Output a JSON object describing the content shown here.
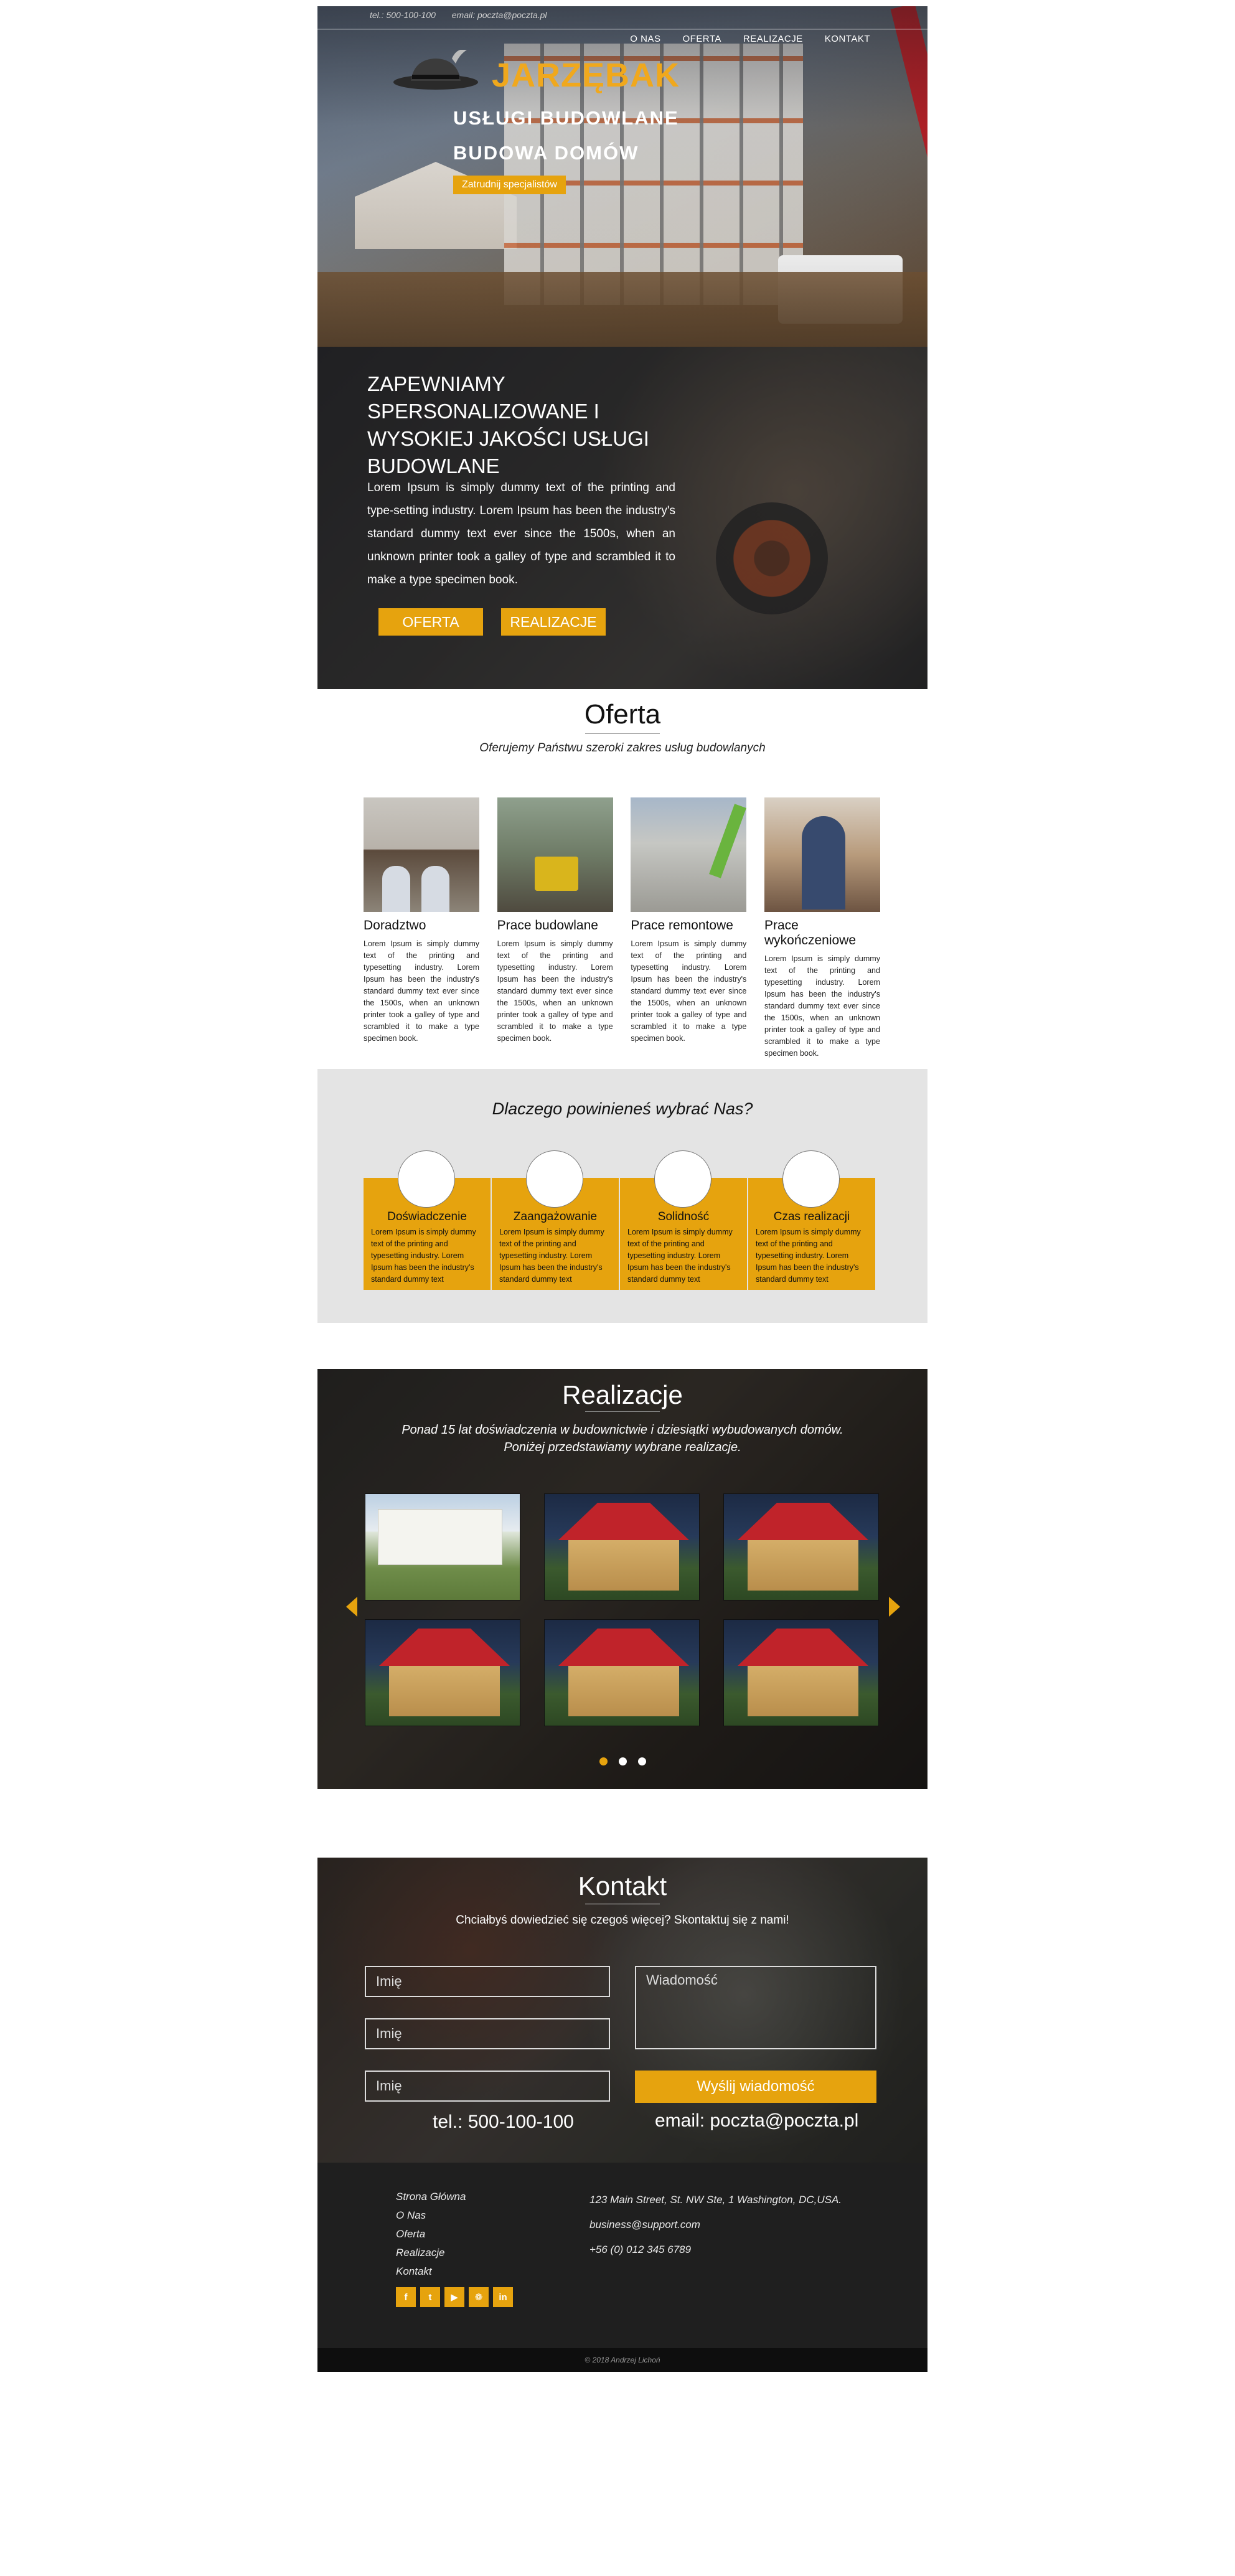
{
  "topbar": {
    "phone": "tel.: 500-100-100",
    "email": "email: poczta@poczta.pl"
  },
  "nav": {
    "items": [
      "O NAS",
      "OFERTA",
      "REALIZACJE",
      "KONTAKT"
    ]
  },
  "logo": {
    "text": "JARZĘBAK"
  },
  "hero": {
    "tagline_1": "USŁUGI BUDOWLANE",
    "tagline_2": "BUDOWA DOMÓW",
    "cta": "Zatrudnij specjalistów"
  },
  "intro": {
    "title": "ZAPEWNIAMY SPERSONALIZOWANE I WYSOKIEJ JAKOŚCI USŁUGI BUDOWLANE",
    "text": "Lorem Ipsum is simply dummy text of the printing and type-setting industry. Lorem Ipsum has been the industry's standard dummy text ever since the 1500s, when an unknown printer took a galley of type and scrambled it to make a type specimen book.",
    "button_offer": "OFERTA",
    "button_realizations": "REALIZACJE"
  },
  "oferta": {
    "title": "Oferta",
    "subtitle": "Oferujemy Państwu szeroki zakres usług budowlanych",
    "services": [
      {
        "title": "Doradztwo",
        "text": "Lorem Ipsum is simply dummy text of the printing and typesetting industry. Lorem Ipsum has been the industry's standard dummy text ever since the 1500s, when an unknown printer took a galley of type and scrambled it to make a type specimen book."
      },
      {
        "title": "Prace budowlane",
        "text": "Lorem Ipsum is simply dummy text of the printing and typesetting industry. Lorem Ipsum has been the industry's standard dummy text ever since the 1500s, when an unknown printer took a galley of type and scrambled it to make a type specimen book."
      },
      {
        "title": "Prace remontowe",
        "text": "Lorem Ipsum is simply dummy text of the printing and typesetting industry. Lorem Ipsum has been the industry's standard dummy text ever since the 1500s, when an unknown printer took a galley of type and scrambled it to make a type specimen book."
      },
      {
        "title": "Prace wykończeniowe",
        "text": "Lorem Ipsum is simply dummy text of the printing and typesetting industry. Lorem Ipsum has been the industry's standard dummy text ever since the 1500s, when an unknown printer took a galley of type and scrambled it to make a type specimen book."
      }
    ]
  },
  "why": {
    "title": "Dlaczego powinieneś wybrać Nas?",
    "features": [
      {
        "title": "Doświadczenie",
        "text": "Lorem Ipsum is simply dummy text of the printing and typesetting industry. Lorem Ipsum has been the industry's standard dummy text"
      },
      {
        "title": "Zaangażowanie",
        "text": "Lorem Ipsum is simply dummy text of the printing and typesetting industry. Lorem Ipsum has been the industry's standard dummy text"
      },
      {
        "title": "Solidność",
        "text": "Lorem Ipsum is simply dummy text of the printing and typesetting industry. Lorem Ipsum has been the industry's standard dummy text"
      },
      {
        "title": "Czas realizacji",
        "text": "Lorem Ipsum is simply dummy text of the printing and typesetting industry. Lorem Ipsum has been the industry's standard dummy text"
      }
    ]
  },
  "realizacje": {
    "title": "Realizacje",
    "subtitle_1": "Ponad 15 lat doświadczenia w budownictwie i dziesiątki wybudowanych domów.",
    "subtitle_2": "Poniżej przedstawiamy wybrane realizacje.",
    "active_slide": 1,
    "slides": 3
  },
  "kontakt": {
    "title": "Kontakt",
    "subtitle": "Chciałbyś dowiedzieć się czegoś więcej? Skontaktuj się z nami!",
    "name_placeholder": "Imię",
    "message_placeholder": "Wiadomość",
    "send": "Wyślij wiadomość",
    "phone": "tel.: 500-100-100",
    "email": "email: poczta@poczta.pl"
  },
  "footer": {
    "links": [
      "Strona Główna",
      "O Nas",
      "Oferta",
      "Realizacje",
      "Kontakt"
    ],
    "address": "123 Main Street, St. NW Ste, 1 Washington, DC,USA.",
    "email": "business@support.com",
    "phone": "+56 (0) 012 345 6789",
    "socials": [
      "f",
      "t",
      "▶",
      "❁",
      "in"
    ],
    "social_icons": [
      "facebook-icon",
      "twitter-icon",
      "youtube-icon",
      "dribbble-icon",
      "linkedin-icon"
    ],
    "copyright": "© 2018 Andrzej Lichoń"
  },
  "colors": {
    "accent": "#e6a30e",
    "footer_bg": "#1f1f1f",
    "why_bg": "#e4e4e4"
  }
}
